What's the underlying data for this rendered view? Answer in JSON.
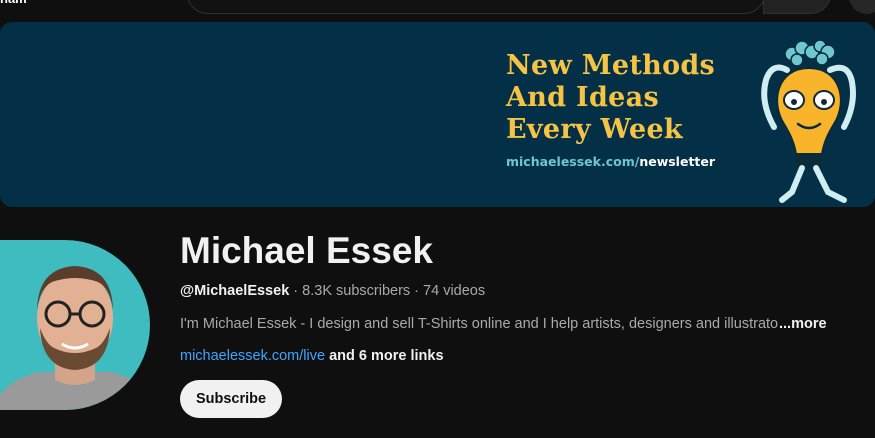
{
  "topbar": {
    "title_fragment": "nam"
  },
  "banner": {
    "headline_lines": [
      "New Methods",
      "And Ideas",
      "Every Week"
    ],
    "link_domain": "michaelessek.com/",
    "link_path": "newsletter",
    "colors": {
      "background": "#043047",
      "headline": "#f6c343",
      "domain": "#6fc7d2"
    }
  },
  "channel": {
    "name": "Michael Essek",
    "handle": "@MichaelEssek",
    "subscribers": "8.3K subscribers",
    "videos": "74 videos",
    "separator": " · ",
    "description": "I'm Michael Essek - I design and sell T-Shirts online and I help artists, designers and illustrators",
    "more_label": "...more",
    "link": "michaelessek.com/live",
    "more_links": "and 6 more links",
    "subscribe_label": "Subscribe"
  },
  "colors": {
    "link": "#3ea6ff",
    "avatar_bg": "#3ebcc0",
    "page_bg": "#0f0f0f"
  }
}
